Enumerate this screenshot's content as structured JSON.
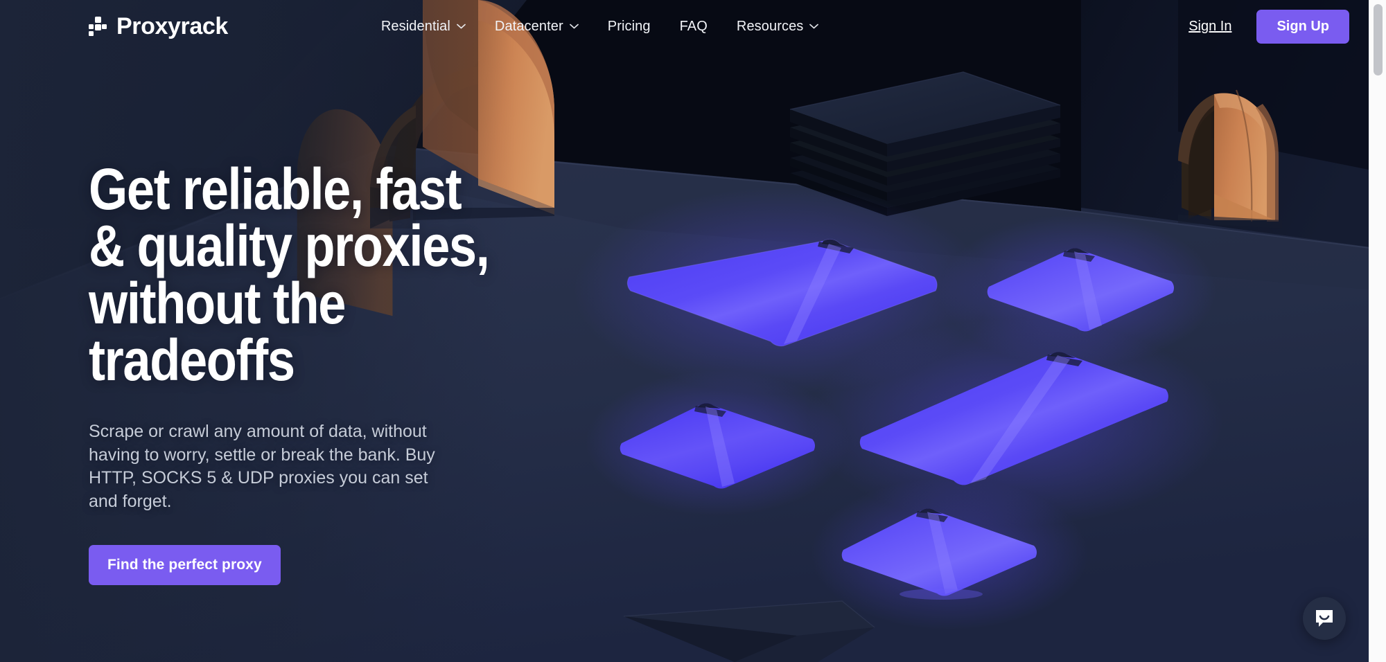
{
  "brand": {
    "name": "Proxyrack",
    "logo_icon": "proxyrack-blocks-icon"
  },
  "nav": {
    "items": [
      {
        "label": "Residential",
        "has_dropdown": true,
        "icon": "chevron-down-icon"
      },
      {
        "label": "Datacenter",
        "has_dropdown": true,
        "icon": "chevron-down-icon"
      },
      {
        "label": "Pricing",
        "has_dropdown": false,
        "icon": ""
      },
      {
        "label": "FAQ",
        "has_dropdown": false,
        "icon": ""
      },
      {
        "label": "Resources",
        "has_dropdown": true,
        "icon": "chevron-down-icon"
      }
    ]
  },
  "auth": {
    "sign_in_label": "Sign In",
    "sign_up_label": "Sign Up"
  },
  "hero": {
    "headline": "Get reliable, fast\n& quality proxies,\nwithout the\ntradeoffs",
    "subcopy": "Scrape or crawl any amount of data, without\nhaving to worry, settle or break the bank. Buy\nHTTP, SOCKS 5 & UDP proxies you can set\nand forget.",
    "cta_label": "Find the perfect proxy"
  },
  "widgets": {
    "chat_icon": "chat-smiley-icon"
  },
  "colors": {
    "accent_purple": "#7a5cf0",
    "panel_blue": "#4a3df2",
    "panel_blue_light": "#6c5cf5",
    "arch_orange": "#c77a49",
    "arch_orange_light": "#d9945f",
    "bg_navy": "#1f2740",
    "bg_dark": "#080b16",
    "floor_navy": "#2b3450",
    "text_muted": "#c6ccd8"
  }
}
